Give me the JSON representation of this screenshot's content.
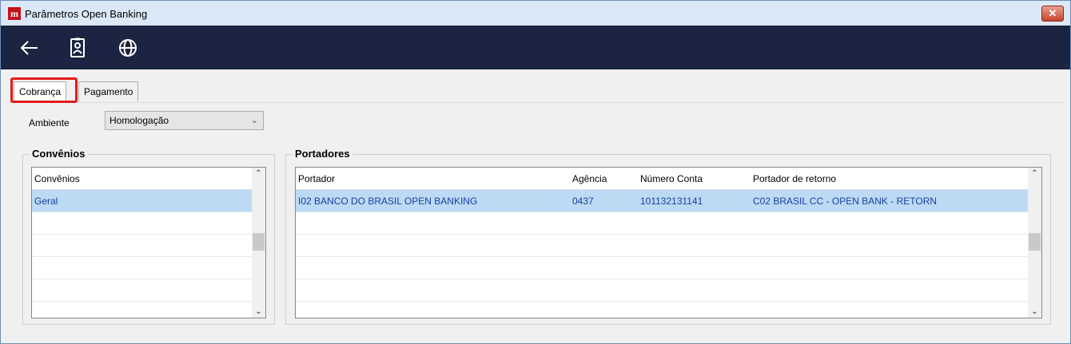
{
  "window": {
    "title": "Parâmetros Open Banking",
    "app_icon_letter": "m",
    "close_symbol": "✕"
  },
  "toolbar": {
    "icons": [
      "back-arrow-icon",
      "id-badge-icon",
      "globe-icon"
    ]
  },
  "tabs": [
    {
      "label": "Cobrança",
      "active": true
    },
    {
      "label": "Pagamento",
      "active": false
    }
  ],
  "ambiente": {
    "label": "Ambiente",
    "value": "Homologação"
  },
  "convenios": {
    "group_title": "Convênios",
    "column_header": "Convênios",
    "rows": [
      "Geral"
    ],
    "selected_index": 0
  },
  "portadores": {
    "group_title": "Portadores",
    "columns": [
      "Portador",
      "Agência",
      "Número Conta",
      "Portador de retorno"
    ],
    "rows": [
      [
        "I02  BANCO DO BRASIL OPEN BANKING",
        "0437",
        "101132131141",
        "C02  BRASIL CC - OPEN BANK - RETORN"
      ]
    ],
    "selected_index": 0
  },
  "colors": {
    "toolbar_bg": "#1b2541",
    "selected_row": "#bcdaf3",
    "highlight_border": "#e31b1b"
  }
}
